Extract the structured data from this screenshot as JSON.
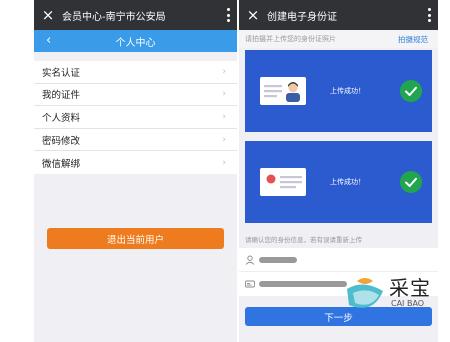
{
  "left_phone": {
    "window_title": "会员中心-南宁市公安局",
    "close_icon": "×",
    "header": {
      "back_icon": "‹",
      "title": "个人中心"
    },
    "menu": [
      {
        "label": "实名认证",
        "chevron": "›"
      },
      {
        "label": "我的证件",
        "chevron": "›"
      },
      {
        "label": "个人资料",
        "chevron": "›"
      },
      {
        "label": "密码修改",
        "chevron": "›"
      },
      {
        "label": "微信解绑",
        "chevron": "›"
      }
    ],
    "logout_label": "退出当前用户"
  },
  "right_phone": {
    "window_title": "创建电子身份证",
    "close_icon": "×",
    "tip": "请拍摄并上传您的身份证照片",
    "tip_link": "拍摄规范",
    "cards": [
      {
        "status": "上传成功！",
        "side": "front"
      },
      {
        "status": "上传成功！",
        "side": "back"
      }
    ],
    "confirm_note": "请确认您的身份信息，若有误请重新上传",
    "info_rows": [
      {
        "icon": "user-icon"
      },
      {
        "icon": "id-card-icon"
      }
    ],
    "next_label": "下一步"
  },
  "watermark": {
    "cn": "采宝",
    "en": "CAI BAO"
  },
  "colors": {
    "title_bar": "#303236",
    "header_blue": "#3a9be9",
    "logout_orange": "#ee7c1f",
    "card_blue": "#2c5bcf",
    "success_green": "#21a64f",
    "next_blue": "#2f74e0"
  }
}
